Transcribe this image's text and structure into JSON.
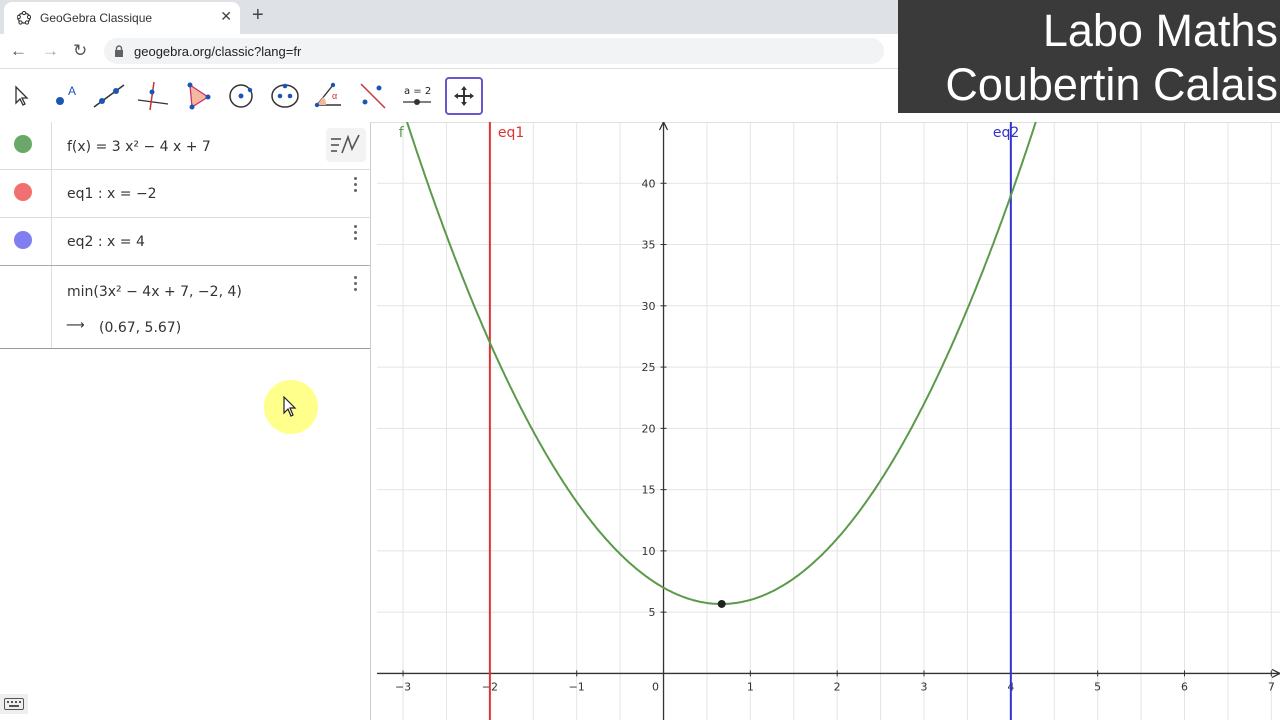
{
  "browser": {
    "tab_title": "GeoGebra Classique",
    "new_tab": "+",
    "url": "geogebra.org/classic?lang=fr"
  },
  "overlay": {
    "line1": "Labo Maths",
    "line2": "Coubertin Calais"
  },
  "toolbar": {
    "tools": [
      "move-tool",
      "point-tool",
      "line-tool",
      "perpendicular-tool",
      "polygon-tool",
      "circle-tool",
      "conic-tool",
      "angle-tool",
      "reflect-tool",
      "slider-tool",
      "move-graphics-tool"
    ],
    "slider_label": "a = 2",
    "active_tool": "move-graphics-tool"
  },
  "algebra": {
    "items": [
      {
        "name": "f",
        "expr": "f(x)  =  3 x² − 4 x + 7",
        "color": "#6aa86a"
      },
      {
        "name": "eq1",
        "expr": "eq1 :  x = −2",
        "color": "#f07070"
      },
      {
        "name": "eq2",
        "expr": "eq2 :  x = 4",
        "color": "#7f7ff2"
      }
    ],
    "command": {
      "input": "min(3x² − 4x + 7, −2, 4)",
      "arrow": "⟶",
      "result": "(0.67, 5.67)"
    }
  },
  "graph": {
    "xlim": [
      -3.3,
      7.1
    ],
    "ylim": [
      -3.8,
      45
    ],
    "x_ticks": [
      -3,
      -2,
      -1,
      0,
      1,
      2,
      3,
      4,
      5,
      6,
      7
    ],
    "y_ticks": [
      5,
      10,
      15,
      20,
      25,
      30,
      35,
      40
    ],
    "x_tick_labels": [
      "−3",
      "−2",
      "−1",
      "0",
      "1",
      "2",
      "3",
      "4",
      "5",
      "6",
      "7"
    ],
    "y_tick_labels": [
      "5",
      "10",
      "15",
      "20",
      "25",
      "30",
      "35",
      "40"
    ],
    "curve_label": "f",
    "eq1_label": "eq1",
    "eq2_label": "eq2",
    "eq1_x": -2,
    "eq2_x": 4,
    "min_point": [
      0.67,
      5.67
    ],
    "coeffs": [
      3,
      -4,
      7
    ],
    "colors": {
      "curve": "#5a9a4a",
      "eq1": "#dd3333",
      "eq2": "#3333cc",
      "grid": "#e4e4e4",
      "axis": "#333333"
    }
  }
}
